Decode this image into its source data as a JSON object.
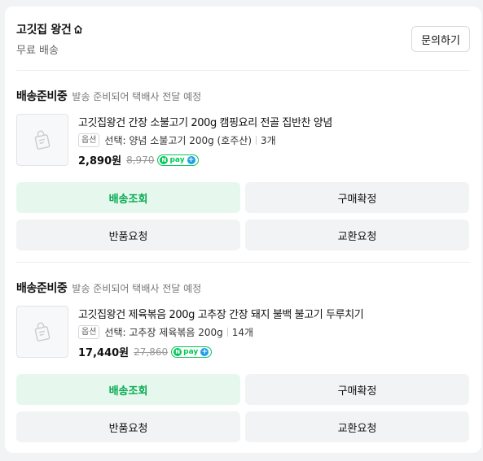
{
  "store": {
    "name": "고깃집 왕건",
    "shipping": "무료 배송",
    "inquiry_label": "문의하기"
  },
  "orders": [
    {
      "status": "배송준비중",
      "status_desc": "발송 준비되어 택배사 전달 예정",
      "product_name": "고깃집왕건 간장 소불고기 200g 캠핑요리 전골 집반찬 양념",
      "option_badge": "옵션",
      "option_text": "선택: 양념 소불고기 200g (호주산)",
      "quantity": "3개",
      "price": "2,890원",
      "original_price": "8,970",
      "buttons": [
        "배송조회",
        "구매확정",
        "반품요청",
        "교환요청"
      ]
    },
    {
      "status": "배송준비중",
      "status_desc": "발송 준비되어 택배사 전달 예정",
      "product_name": "고깃집왕건 제육볶음 200g 고추장 간장 돼지 불백 불고기 두루치기",
      "option_badge": "옵션",
      "option_text": "선택: 고추장 제육볶음 200g",
      "quantity": "14개",
      "price": "17,440원",
      "original_price": "27,860",
      "buttons": [
        "배송조회",
        "구매확정",
        "반품요청",
        "교환요청"
      ]
    }
  ],
  "npay_label": "pay",
  "colors": {
    "accent": "#03c75a",
    "primary_button_bg": "#e6f8ee",
    "primary_button_text": "#03a94e",
    "secondary_button_bg": "#f2f3f5"
  },
  "icons": {
    "store_home": "home-icon",
    "product_thumbnail": "shopping-bag-placeholder-icon",
    "npay": "npay-plus-badge-icon"
  }
}
